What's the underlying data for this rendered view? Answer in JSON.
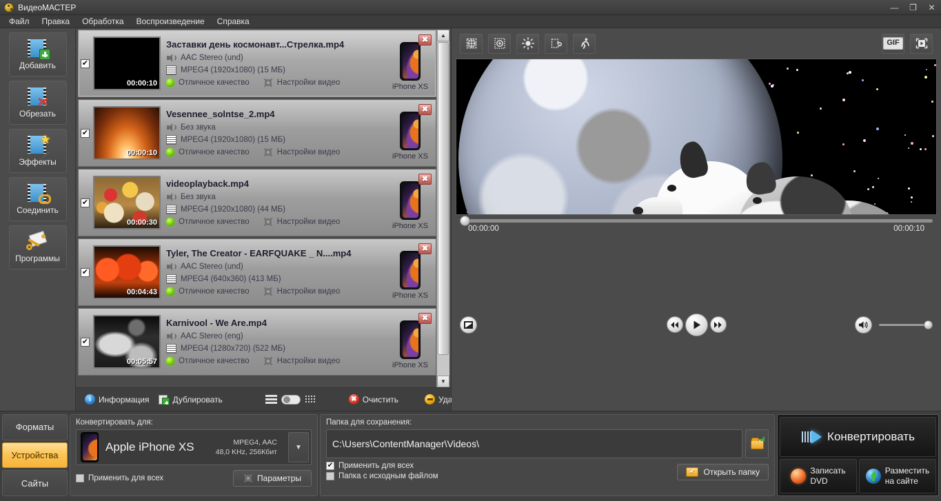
{
  "window": {
    "title": "ВидеоМАСТЕР",
    "logo_icon": "film-reel-icon",
    "minimize_label": "—",
    "maximize_label": "❐",
    "close_label": "✕"
  },
  "menubar": {
    "items": [
      {
        "label": "Файл",
        "name": "menu-file"
      },
      {
        "label": "Правка",
        "name": "menu-edit"
      },
      {
        "label": "Обработка",
        "name": "menu-process"
      },
      {
        "label": "Воспроизведение",
        "name": "menu-playback"
      },
      {
        "label": "Справка",
        "name": "menu-help"
      }
    ]
  },
  "tools": {
    "items": [
      {
        "label": "Добавить",
        "icon": "film-plus-icon"
      },
      {
        "label": "Обрезать",
        "icon": "film-scissors-icon"
      },
      {
        "label": "Эффекты",
        "icon": "film-magic-wand-icon"
      },
      {
        "label": "Соединить",
        "icon": "film-link-icon"
      },
      {
        "label": "Программы",
        "icon": "key-document-icon"
      }
    ]
  },
  "filelist": {
    "rows": [
      {
        "name": "Заставки день космонавт...Стрелка.mp4",
        "duration": "00:00:10",
        "audio": "AAC Stereo (und)",
        "video": "MPEG4 (1920x1080) (15 МБ)",
        "quality": "Отличное качество",
        "settings": "Настройки видео",
        "device": "iPhone XS",
        "checked": true,
        "selected": true,
        "thumb_class": "th-space"
      },
      {
        "name": "Vesennee_solntse_2.mp4",
        "duration": "00:00:10",
        "audio": "Без звука",
        "video": "MPEG4 (1920x1080) (15 МБ)",
        "quality": "Отличное качество",
        "settings": "Настройки видео",
        "device": "iPhone XS",
        "checked": true,
        "selected": false,
        "thumb_class": "th-sun"
      },
      {
        "name": "videoplayback.mp4",
        "duration": "00:00:30",
        "audio": "Без звука",
        "video": "MPEG4 (1920x1080) (44 МБ)",
        "quality": "Отличное качество",
        "settings": "Настройки видео",
        "device": "iPhone XS",
        "checked": true,
        "selected": false,
        "thumb_class": "th-food"
      },
      {
        "name": "Tyler, The Creator - EARFQUAKE _ N....mp4",
        "duration": "00:04:43",
        "audio": "AAC Stereo (und)",
        "video": "MPEG4 (640x360) (413 МБ)",
        "quality": "Отличное качество",
        "settings": "Настройки видео",
        "device": "iPhone XS",
        "checked": true,
        "selected": false,
        "thumb_class": "th-red"
      },
      {
        "name": "Karnivool - We Are.mp4",
        "duration": "00:05:57",
        "audio": "AAC Stereo (eng)",
        "video": "MPEG4 (1280x720) (522 МБ)",
        "quality": "Отличное качество",
        "settings": "Настройки видео",
        "device": "iPhone XS",
        "checked": true,
        "selected": false,
        "thumb_class": "th-girl"
      }
    ],
    "remove_label": "✖",
    "scroll_up": "▲",
    "scroll_down": "▼"
  },
  "list_toolbar": {
    "info_label": "Информация",
    "info_glyph": "i",
    "duplicate_label": "Дублировать",
    "clear_label": "Очистить",
    "clear_glyph": "✖",
    "delete_label": "Удалить"
  },
  "player_toolbar": {
    "buttons": [
      {
        "icon": "crop-icon"
      },
      {
        "icon": "watermark-icon"
      },
      {
        "icon": "brightness-icon"
      },
      {
        "icon": "rotate-icon"
      },
      {
        "icon": "speed-run-icon"
      }
    ],
    "gif_label": "GIF",
    "fullscreen_icon": "fullscreen-play-icon"
  },
  "player": {
    "time_current": "00:00:00",
    "time_total": "00:00:10",
    "snapshot_icon": "snapshot-icon",
    "prev_label": "⏮",
    "play_label": "▶",
    "next_label": "⏭",
    "volume_icon": "volume-icon",
    "seek_position_pct": 0,
    "volume_pct": 100
  },
  "categories": {
    "tabs": [
      {
        "label": "Форматы",
        "active": false
      },
      {
        "label": "Устройства",
        "active": true
      },
      {
        "label": "Сайты",
        "active": false
      }
    ]
  },
  "convert_panel": {
    "label": "Конвертировать для:",
    "device_name": "Apple iPhone XS",
    "codec_line1": "MPEG4, AAC",
    "codec_line2": "48,0 KHz, 256Кбит",
    "dropdown_glyph": "▼",
    "apply_all_label": "Применить для всех",
    "apply_all_checked": false,
    "params_label": "Параметры"
  },
  "save_panel": {
    "label": "Папка для сохранения:",
    "path": "C:\\Users\\ContentManager\\Videos\\",
    "browse_icon": "open-folder-icon",
    "apply_all_label": "Применить для всех",
    "apply_all_checked": true,
    "source_folder_label": "Папка с исходным файлом",
    "source_folder_checked": false,
    "open_folder_label": "Открыть папку",
    "check_glyph": "✔"
  },
  "actions": {
    "convert_label": "Конвертировать",
    "burn_dvd_line1": "Записать",
    "burn_dvd_line2": "DVD",
    "publish_line1": "Разместить",
    "publish_line2": "на сайте"
  },
  "colors": {
    "accent_orange": "#fcc455",
    "window_bg": "#3f3f3f",
    "panel_bg": "#474747",
    "row_bg": "#9d9d9d",
    "quality_green": "#6fd000",
    "convert_blue": "#5bb8ef"
  }
}
